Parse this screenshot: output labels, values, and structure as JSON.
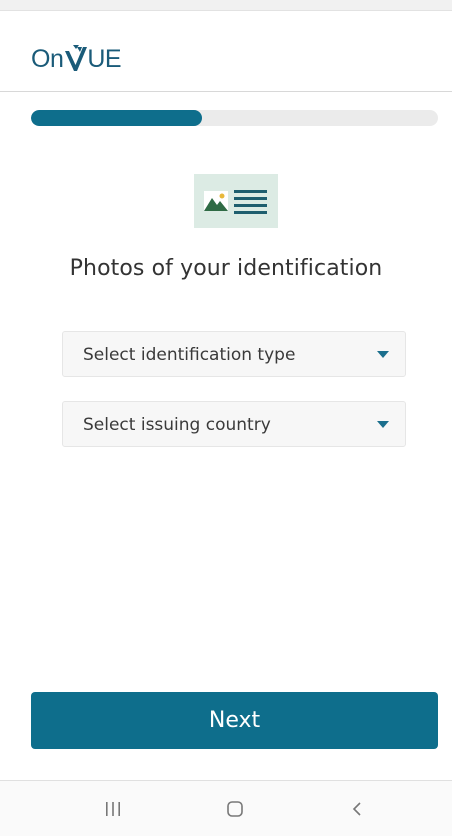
{
  "app": {
    "logo_text_left": "On",
    "logo_text_right": "UE",
    "brand_color": "#1a5b79",
    "accent_color": "#0e6e8c"
  },
  "progress": {
    "fraction": 0.42
  },
  "main": {
    "icon": "id-photo-document-icon",
    "title": "Photos of your identification",
    "selects": {
      "id_type": {
        "label": "Select identification type",
        "icon": "dropdown-caret-icon"
      },
      "country": {
        "label": "Select issuing country",
        "icon": "dropdown-caret-icon"
      }
    },
    "next_label": "Next"
  },
  "system_nav": {
    "recents_icon": "recent-apps-icon",
    "home_icon": "home-icon",
    "back_icon": "back-icon"
  }
}
